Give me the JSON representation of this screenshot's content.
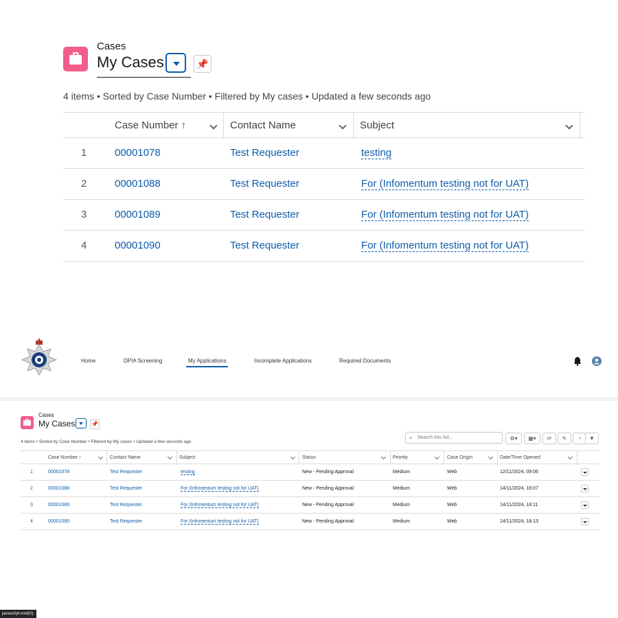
{
  "zoom": {
    "object_label": "Cases",
    "list_title": "My Cases",
    "meta": "4 items • Sorted by Case Number • Filtered by My cases • Updated a few seconds ago",
    "columns": [
      "Case Number",
      "Contact Name",
      "Subject"
    ],
    "sort_arrow": "↑",
    "rows": [
      {
        "n": "1",
        "case": "00001078",
        "contact": "Test Requester",
        "subject": "testing"
      },
      {
        "n": "2",
        "case": "00001088",
        "contact": "Test Requester",
        "subject": "For (Infomentum testing not for UAT)"
      },
      {
        "n": "3",
        "case": "00001089",
        "contact": "Test Requester",
        "subject": "For (Infomentum testing not for UAT)"
      },
      {
        "n": "4",
        "case": "00001090",
        "contact": "Test Requester",
        "subject": "For (Infomentum testing not for UAT)"
      }
    ]
  },
  "nav": {
    "items": [
      "Home",
      "DPIA Screening",
      "My Applications",
      "Incomplete Applications",
      "Required Documents"
    ],
    "active": "My Applications"
  },
  "list": {
    "object_label": "Cases",
    "list_title": "My Cases",
    "meta": "4 items • Sorted by Case Number • Filtered by My cases • Updated a few seconds ago",
    "search_placeholder": "Search this list...",
    "columns": [
      "Case Number",
      "Contact Name",
      "Subject",
      "Status",
      "Priority",
      "Case Origin",
      "Date/Time Opened"
    ],
    "sort_arrow": "↑",
    "rows": [
      {
        "n": "1",
        "case": "00001078",
        "contact": "Test Requester",
        "subject": "testing",
        "status": "New - Pending Approval",
        "priority": "Medium",
        "origin": "Web",
        "opened": "12/11/2024, 09:06"
      },
      {
        "n": "2",
        "case": "00001088",
        "contact": "Test Requester",
        "subject": "For (Infomentum testing not for UAT)",
        "status": "New - Pending Approval",
        "priority": "Medium",
        "origin": "Web",
        "opened": "14/11/2024, 18:07"
      },
      {
        "n": "3",
        "case": "00001089",
        "contact": "Test Requester",
        "subject": "For (Infomentum testing not for UAT)",
        "status": "New - Pending Approval",
        "priority": "Medium",
        "origin": "Web",
        "opened": "14/11/2024, 18:11"
      },
      {
        "n": "4",
        "case": "00001090",
        "contact": "Test Requester",
        "subject": "For (Infomentum testing not for UAT)",
        "status": "New - Pending Approval",
        "priority": "Medium",
        "origin": "Web",
        "opened": "14/11/2024, 18:13"
      }
    ]
  },
  "status_bar": "javascript:void(0);",
  "colors": {
    "accent": "#0b5cab",
    "case_icon": "#f25d8c"
  }
}
